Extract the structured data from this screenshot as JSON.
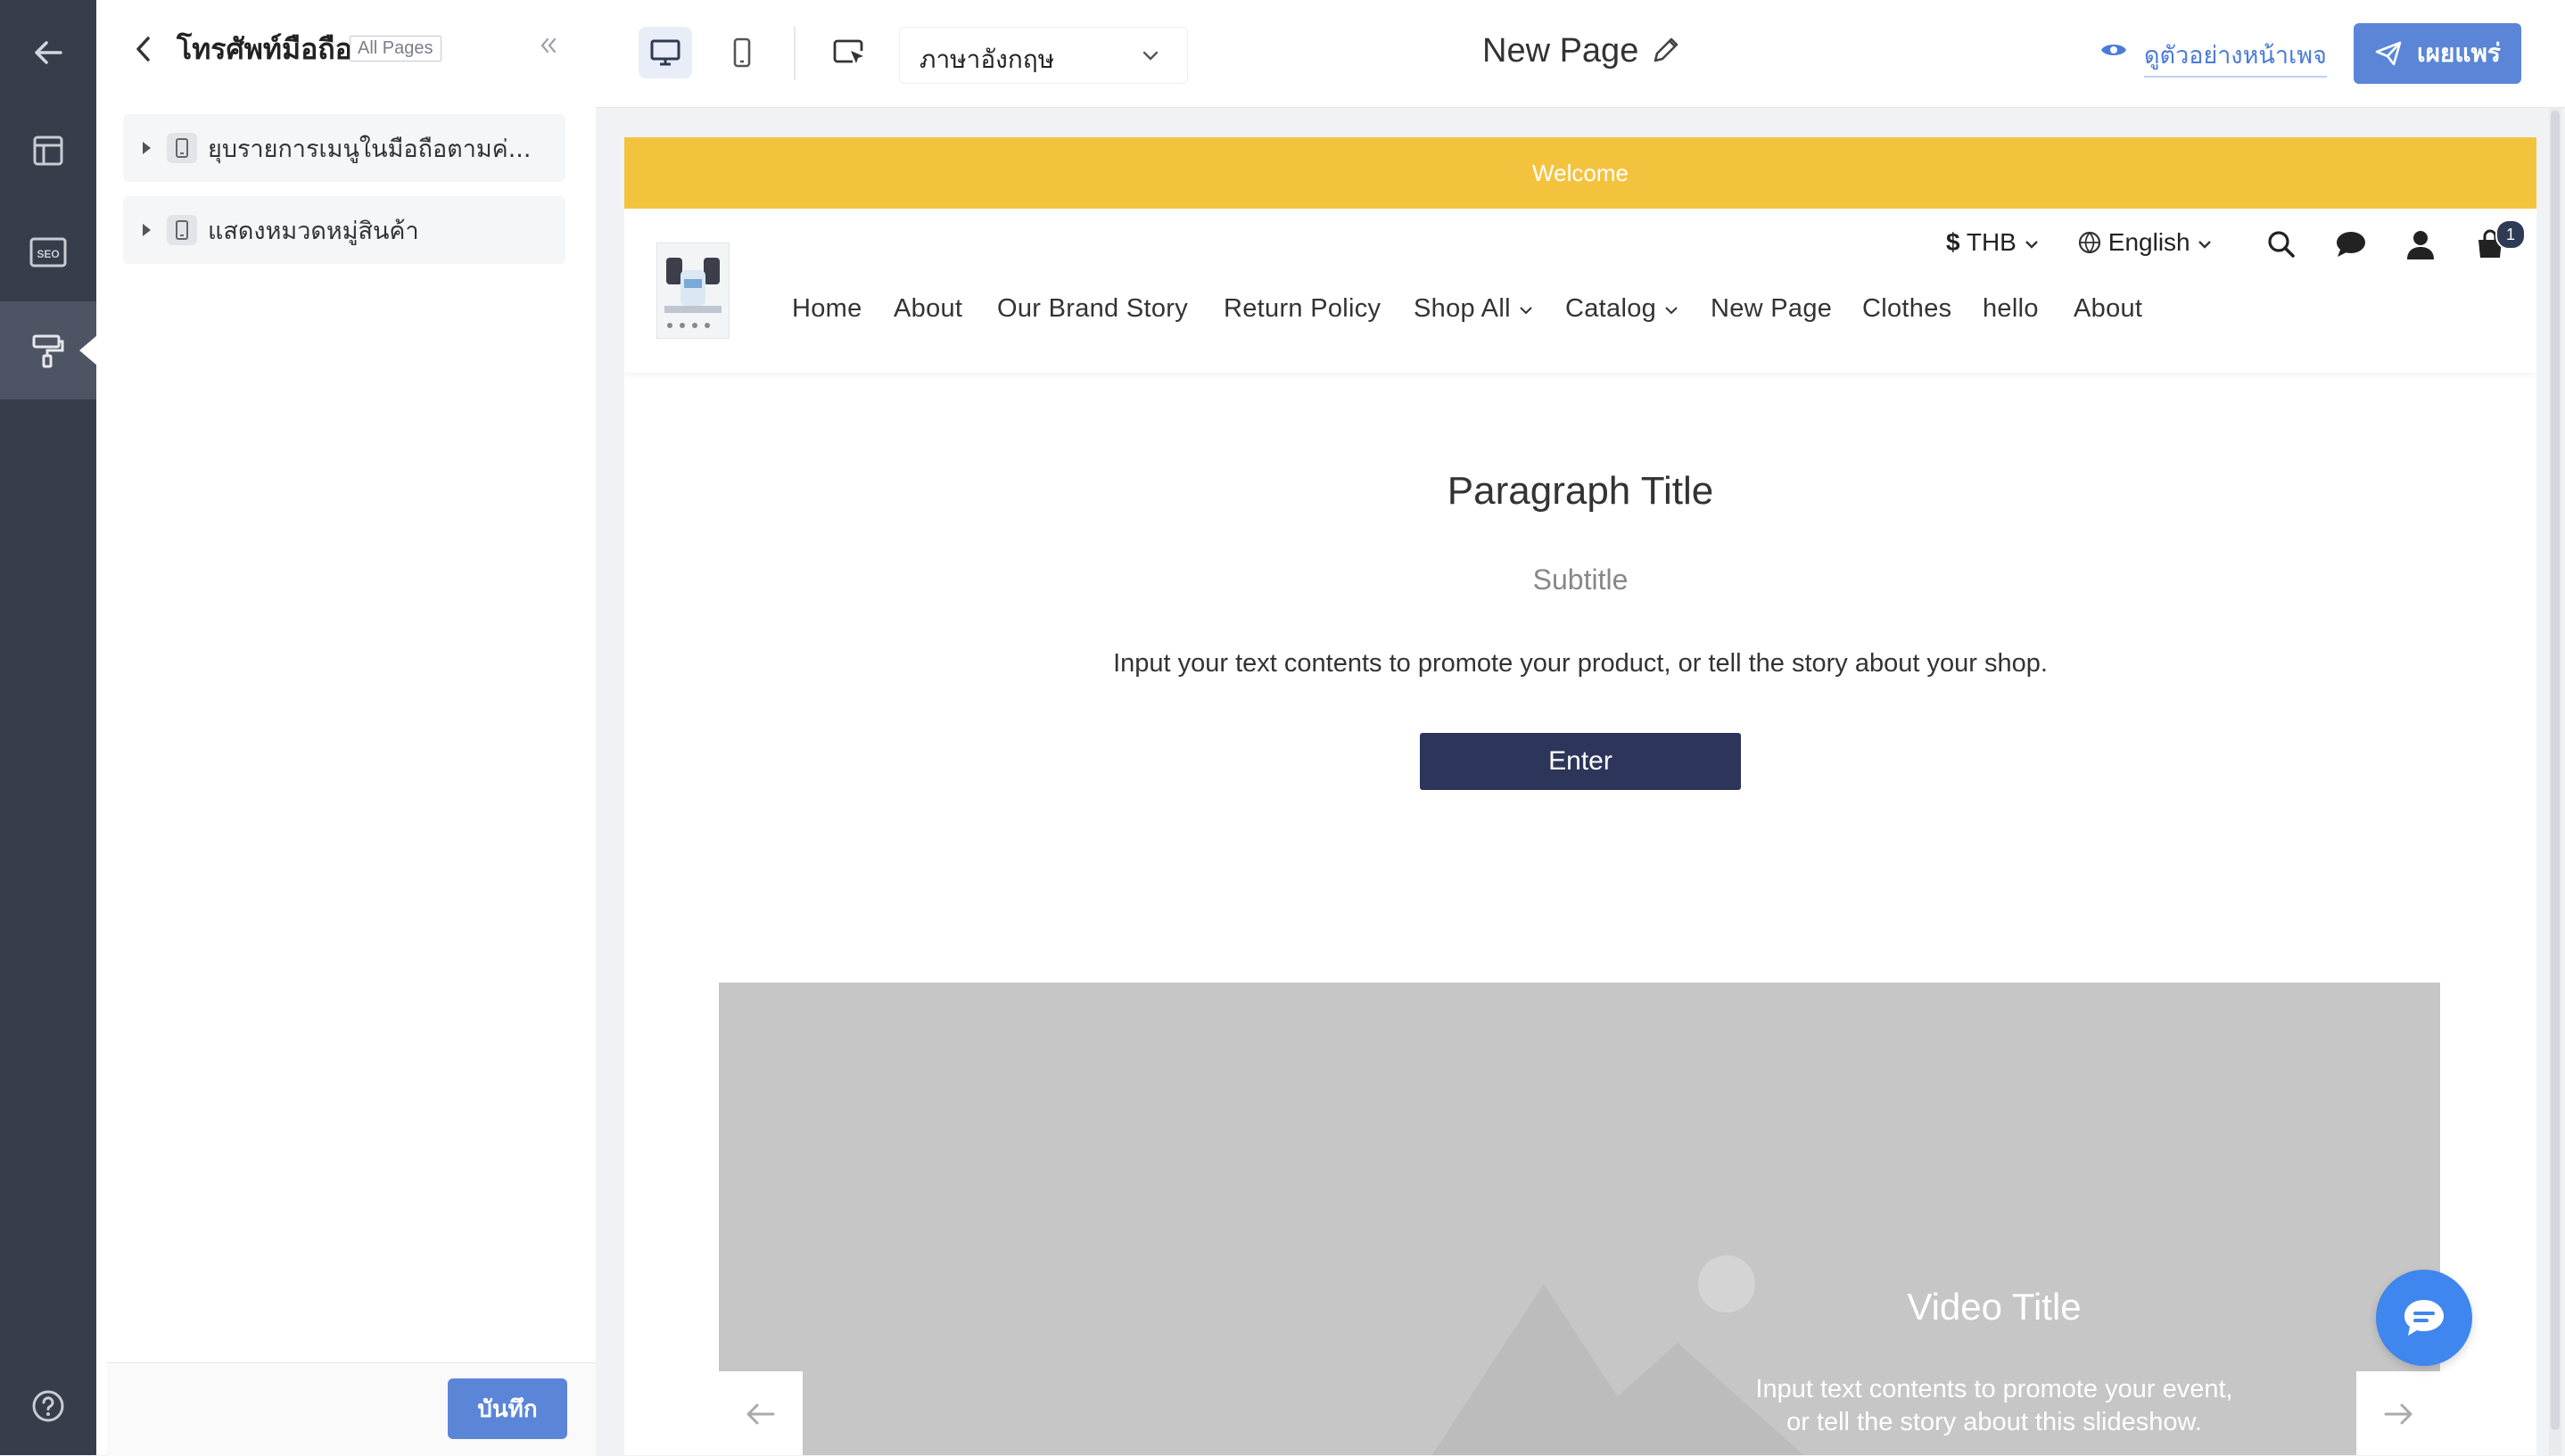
{
  "rail": {
    "items": [
      {
        "icon": "back-arrow-icon"
      },
      {
        "icon": "layout-icon"
      },
      {
        "icon": "seo-icon",
        "label": "SEO"
      },
      {
        "icon": "paint-roller-icon",
        "active": true
      }
    ],
    "help_icon": "help-icon"
  },
  "panel": {
    "title": "โทรศัพท์มือถือ",
    "badge": "All Pages",
    "items": [
      {
        "label": "ยุบรายการเมนูในมือถือตามค่..."
      },
      {
        "label": "แสดงหมวดหมู่สินค้า"
      }
    ],
    "save_label": "บันทึก"
  },
  "toolbar": {
    "language": "ภาษาอังกฤษ",
    "page_title": "New Page",
    "preview_label": "ดูตัวอย่างหน้าเพจ",
    "publish_label": "เผยแพร่"
  },
  "store": {
    "welcome": "Welcome",
    "currency_symbol": "$",
    "currency": "THB",
    "language": "English",
    "cart_count": "1",
    "nav": [
      "Home",
      "About",
      "Our Brand Story",
      "Return Policy",
      "Shop All",
      "Catalog",
      "New Page",
      "Clothes",
      "hello",
      "About"
    ]
  },
  "content": {
    "paragraph_title": "Paragraph Title",
    "subtitle": "Subtitle",
    "body": "Input your text contents to promote your product, or tell the story about your shop.",
    "button_label": "Enter"
  },
  "slideshow": {
    "video_title": "Video Title",
    "desc_line1": "Input text contents to promote your event,",
    "desc_line2": "or tell the story about this slideshow."
  },
  "colors": {
    "accent": "#5b86d8",
    "banner": "#f4c33e",
    "rail": "#373d4b",
    "button_dark": "#2d355a",
    "chat": "#3f86ef"
  }
}
